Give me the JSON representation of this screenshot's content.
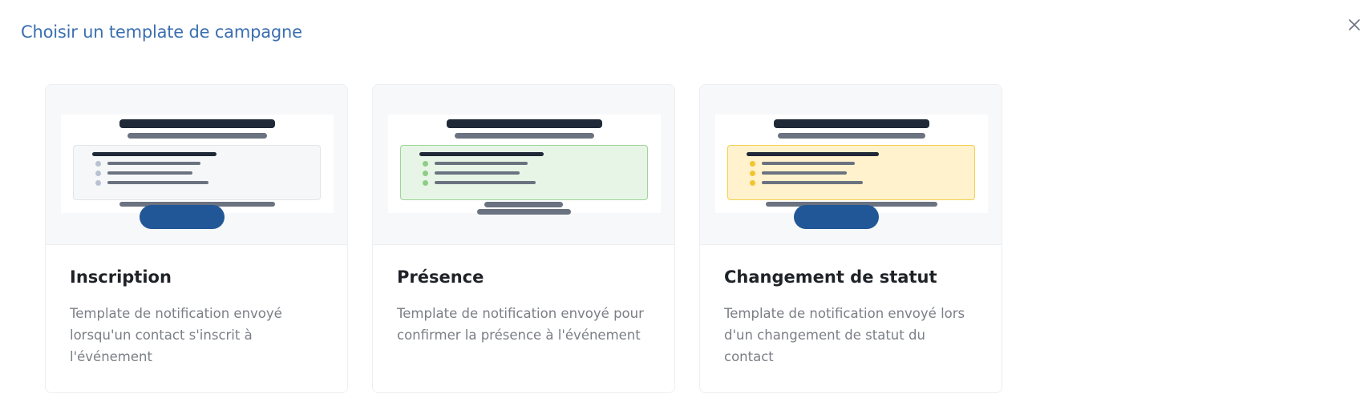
{
  "modal": {
    "title": "Choisir un template de campagne",
    "close_icon": "close-icon"
  },
  "templates": [
    {
      "title": "Inscription",
      "description": "Template de notification envoyé lorsqu'un contact s'inscrit à l'événement",
      "accent": "neutral"
    },
    {
      "title": "Présence",
      "description": "Template de notification envoyé pour confirmer la présence à l'événement",
      "accent": "green"
    },
    {
      "title": "Changement de statut",
      "description": "Template de notification envoyé lors d'un changement de statut du contact",
      "accent": "yellow"
    }
  ],
  "colors": {
    "title": "#3b6fb0",
    "cta": "#215796",
    "green_box": "#e7f5e6",
    "yellow_box": "#fff2cc"
  }
}
